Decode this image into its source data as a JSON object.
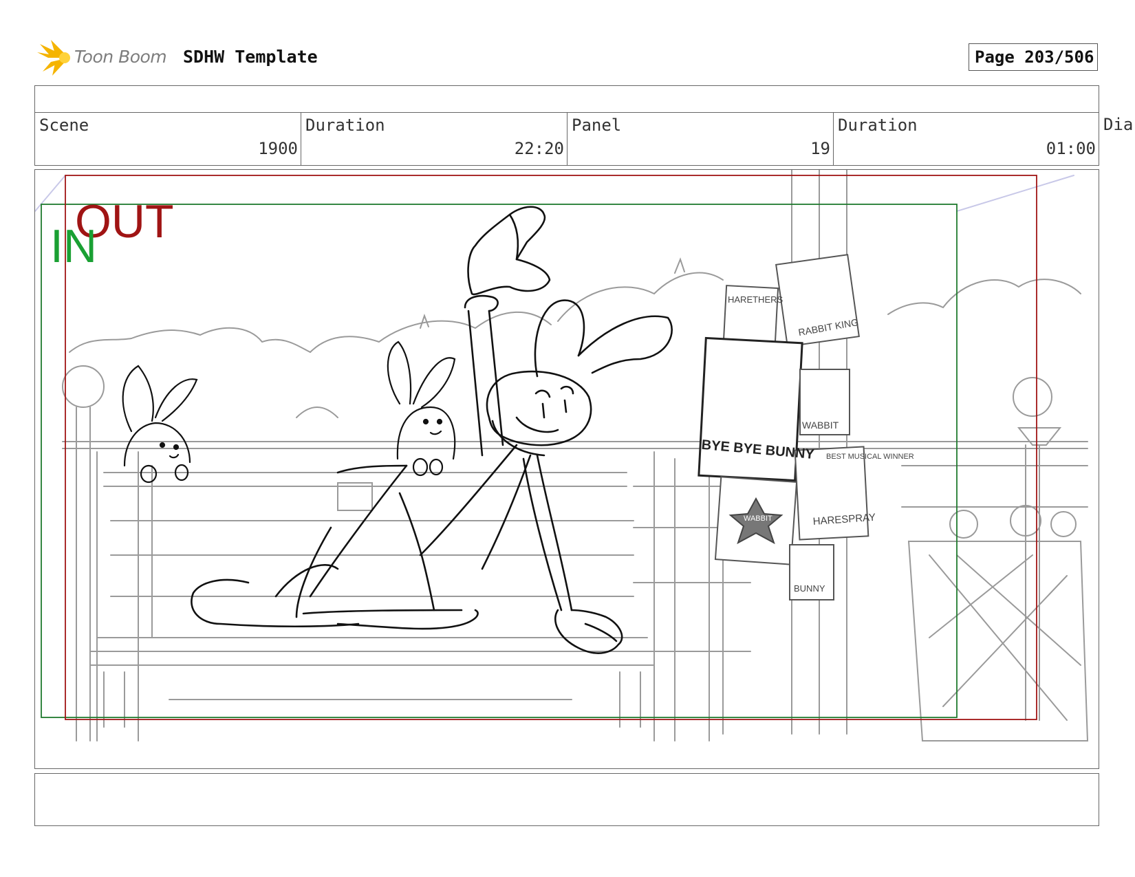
{
  "header": {
    "brand": "Toon Boom",
    "template_title": "SDHW Template",
    "page_label": "Page 203/506"
  },
  "info": {
    "scene_label": "Scene",
    "scene_value": "1900",
    "scene_duration_label": "Duration",
    "scene_duration_value": "22:20",
    "panel_label": "Panel",
    "panel_value": "19",
    "panel_duration_label": "Duration",
    "panel_duration_value": "01:00",
    "dialogue_label": "Dia"
  },
  "frame": {
    "in_label": "IN",
    "out_label": "OUT",
    "in_color": "#1aa033",
    "out_color": "#a01414"
  },
  "posters": {
    "harethers": "HARETHERS",
    "rabbit_king": "RABBIT KING",
    "bye_bye_bunny": "BYE BYE BUNNY",
    "wabbit": "WABBIT",
    "best_musical": "BEST MUSICAL WINNER",
    "wabbit_star": "WABBIT",
    "harespray": "HARESPRAY",
    "bunny": "BUNNY"
  }
}
